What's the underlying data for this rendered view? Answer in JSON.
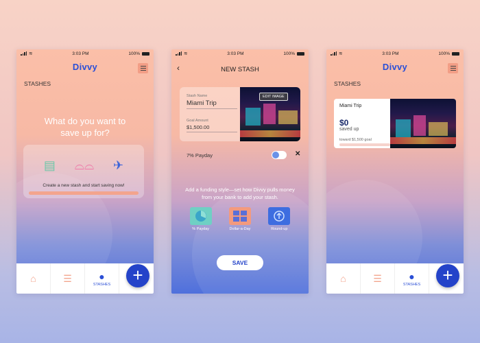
{
  "status": {
    "time": "3:03 PM",
    "battery": "100%"
  },
  "brand": {
    "logo": "Divvy"
  },
  "screen1": {
    "section_title": "STASHES",
    "headline_1": "What do you want to",
    "headline_2": "save up for?",
    "card_text": "Create a new stash and start saving now!",
    "icons": [
      "coins-icon",
      "glasses-icon",
      "plane-icon"
    ]
  },
  "screen2": {
    "title": "NEW STASH",
    "name_label": "Stash Name",
    "name_value": "Miami Trip",
    "amount_label": "Goal Amount",
    "amount_value": "$1,500.00",
    "edit_image": "EDIT IMAGE",
    "payday_label": "7% Payday",
    "style_text": "Add a funding style—set how Divvy pulls money from your bank to add your stash.",
    "fund_options": [
      {
        "label": "% Payday",
        "color": "#6fd0c4"
      },
      {
        "label": "Dollar-a-Day",
        "color": "#f39a7e"
      },
      {
        "label": "Round-up",
        "color": "#3d6de0"
      }
    ],
    "save": "SAVE"
  },
  "screen3": {
    "section_title": "STASHES",
    "stash_name": "Miami Trip",
    "amount": "$0",
    "saved_label": "saved up",
    "goal_text": "toward $1,500 goal"
  },
  "nav": {
    "stashes": "STASHES"
  },
  "colors": {
    "accent": "#2443c9",
    "peach": "#f3a48d"
  }
}
